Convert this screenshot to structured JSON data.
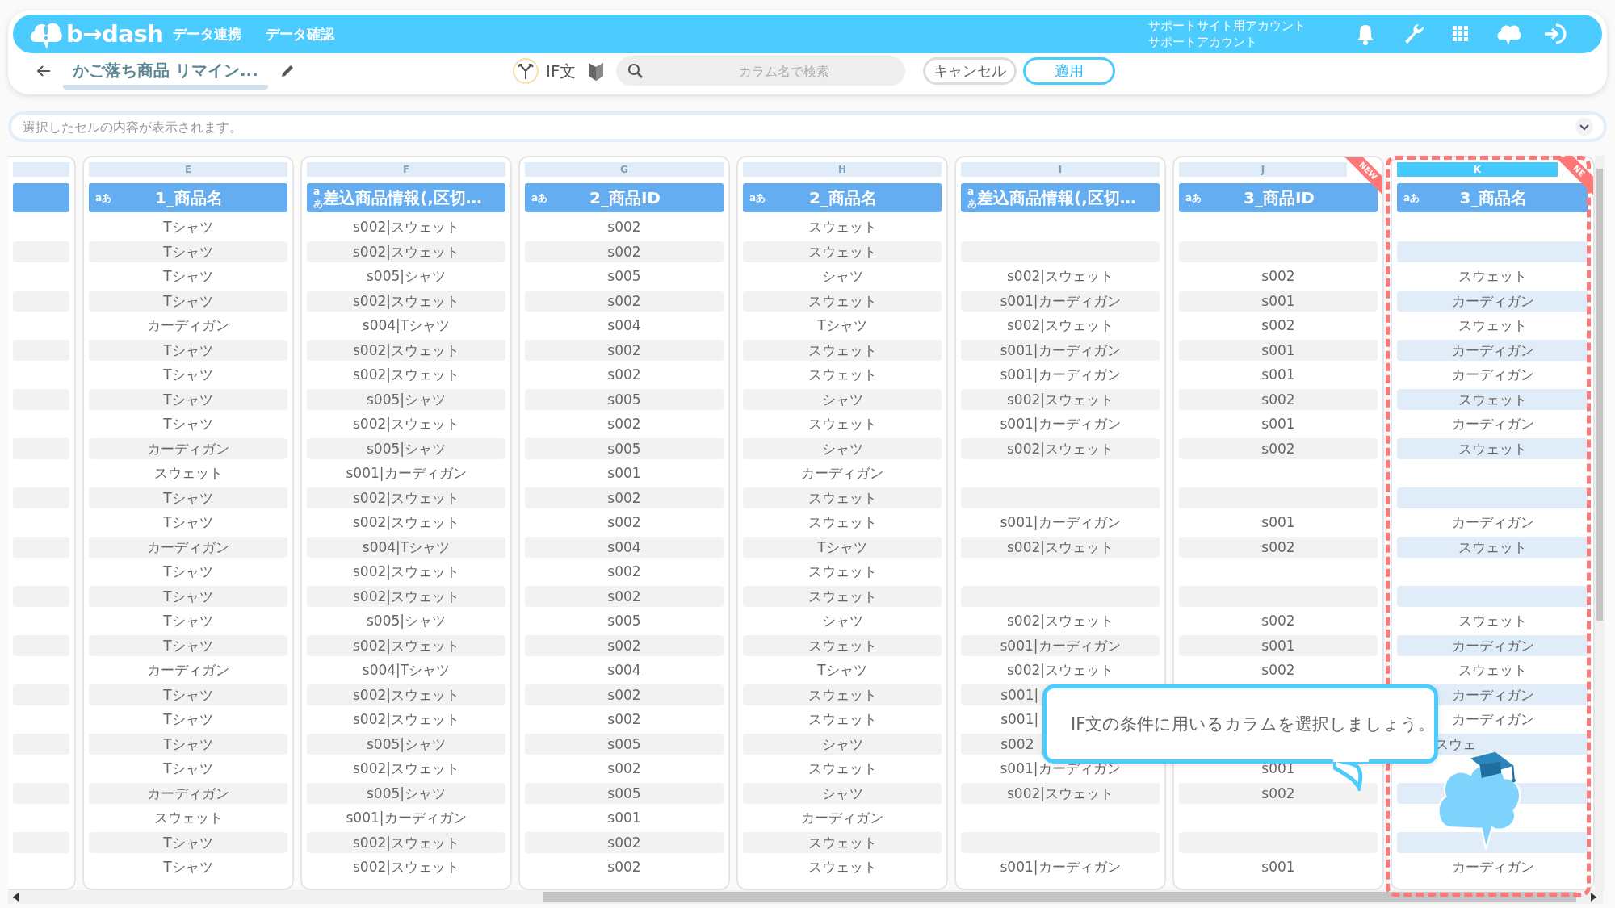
{
  "app_bar": {
    "logo": "b→dash",
    "nav": [
      {
        "label": "データ連携"
      },
      {
        "label": "データ確認"
      }
    ],
    "account": [
      "サポートサイト用アカウント",
      "サポートアカウント"
    ]
  },
  "toolbar": {
    "title": "かご落ち商品 リマイン...",
    "if_label": "IF文",
    "search": {
      "placeholder": "カラム名で検索"
    },
    "buttons": [
      {
        "label": "キャンセル",
        "kind": "secondary"
      },
      {
        "label": "適用",
        "kind": "primary"
      }
    ]
  },
  "cell_preview": {
    "placeholder": "選択したセルの内容が表示されます。"
  },
  "table": {
    "columns": [
      {
        "letter": "E",
        "type": "aあ",
        "name": "1_商品名",
        "selected": false
      },
      {
        "letter": "F",
        "type": "aあ",
        "name": "差込商品情報(,区切…",
        "selected": false
      },
      {
        "letter": "G",
        "type": "aあ",
        "name": "2_商品ID",
        "selected": false
      },
      {
        "letter": "H",
        "type": "aあ",
        "name": "2_商品名",
        "selected": false
      },
      {
        "letter": "I",
        "type": "aあ",
        "name": "差込商品情報(,区切…",
        "selected": false
      },
      {
        "letter": "J",
        "type": "aあ",
        "name": "3_商品ID",
        "selected": false,
        "badge": "NEW"
      },
      {
        "letter": "K",
        "type": "aあ",
        "name": "3_商品名",
        "selected": true,
        "badge": "NE"
      }
    ],
    "rows": [
      [
        "Tシャツ",
        "s002|スウェット",
        "s002",
        "スウェット",
        "",
        "",
        ""
      ],
      [
        "Tシャツ",
        "s002|スウェット",
        "s002",
        "スウェット",
        "",
        "",
        ""
      ],
      [
        "Tシャツ",
        "s005|シャツ",
        "s005",
        "シャツ",
        "s002|スウェット",
        "s002",
        "スウェット"
      ],
      [
        "Tシャツ",
        "s002|スウェット",
        "s002",
        "スウェット",
        "s001|カーディガン",
        "s001",
        "カーディガン"
      ],
      [
        "カーディガン",
        "s004|Tシャツ",
        "s004",
        "Tシャツ",
        "s002|スウェット",
        "s002",
        "スウェット"
      ],
      [
        "Tシャツ",
        "s002|スウェット",
        "s002",
        "スウェット",
        "s001|カーディガン",
        "s001",
        "カーディガン"
      ],
      [
        "Tシャツ",
        "s002|スウェット",
        "s002",
        "スウェット",
        "s001|カーディガン",
        "s001",
        "カーディガン"
      ],
      [
        "Tシャツ",
        "s005|シャツ",
        "s005",
        "シャツ",
        "s002|スウェット",
        "s002",
        "スウェット"
      ],
      [
        "Tシャツ",
        "s002|スウェット",
        "s002",
        "スウェット",
        "s001|カーディガン",
        "s001",
        "カーディガン"
      ],
      [
        "カーディガン",
        "s005|シャツ",
        "s005",
        "シャツ",
        "s002|スウェット",
        "s002",
        "スウェット"
      ],
      [
        "スウェット",
        "s001|カーディガン",
        "s001",
        "カーディガン",
        "",
        "",
        ""
      ],
      [
        "Tシャツ",
        "s002|スウェット",
        "s002",
        "スウェット",
        "",
        "",
        ""
      ],
      [
        "Tシャツ",
        "s002|スウェット",
        "s002",
        "スウェット",
        "s001|カーディガン",
        "s001",
        "カーディガン"
      ],
      [
        "カーディガン",
        "s004|Tシャツ",
        "s004",
        "Tシャツ",
        "s002|スウェット",
        "s002",
        "スウェット"
      ],
      [
        "Tシャツ",
        "s002|スウェット",
        "s002",
        "スウェット",
        "",
        "",
        ""
      ],
      [
        "Tシャツ",
        "s002|スウェット",
        "s002",
        "スウェット",
        "",
        "",
        ""
      ],
      [
        "Tシャツ",
        "s005|シャツ",
        "s005",
        "シャツ",
        "s002|スウェット",
        "s002",
        "スウェット"
      ],
      [
        "Tシャツ",
        "s002|スウェット",
        "s002",
        "スウェット",
        "s001|カーディガン",
        "s001",
        "カーディガン"
      ],
      [
        "カーディガン",
        "s004|Tシャツ",
        "s004",
        "Tシャツ",
        "s002|スウェット",
        "s002",
        "スウェット"
      ],
      [
        "Tシャツ",
        "s002|スウェット",
        "s002",
        "スウェット",
        {
          "text": "s001|",
          "clipped": true
        },
        "",
        "カーディガン"
      ],
      [
        "Tシャツ",
        "s002|スウェット",
        "s002",
        "スウェット",
        {
          "text": "s001|",
          "clipped": true
        },
        "",
        "カーディガン"
      ],
      [
        "Tシャツ",
        "s005|シャツ",
        "s005",
        "シャツ",
        {
          "text": "s002",
          "clipped": true
        },
        "",
        {
          "text": "スウェ",
          "clipped": true
        }
      ],
      [
        "Tシャツ",
        "s002|スウェット",
        "s002",
        "スウェット",
        "s001|カーディガン",
        "s001",
        ""
      ],
      [
        "カーディガン",
        "s005|シャツ",
        "s005",
        "シャツ",
        "s002|スウェット",
        "s002",
        ""
      ],
      [
        "スウェット",
        "s001|カーディガン",
        "s001",
        "カーディガン",
        "",
        "",
        ""
      ],
      [
        "Tシャツ",
        "s002|スウェット",
        "s002",
        "スウェット",
        "",
        "",
        ""
      ],
      [
        "Tシャツ",
        "s002|スウェット",
        "s002",
        "スウェット",
        "s001|カーディガン",
        "s001",
        "カーディガン"
      ]
    ]
  },
  "tooltip": {
    "text": "IF文の条件に用いるカラムを選択しましょう。"
  }
}
